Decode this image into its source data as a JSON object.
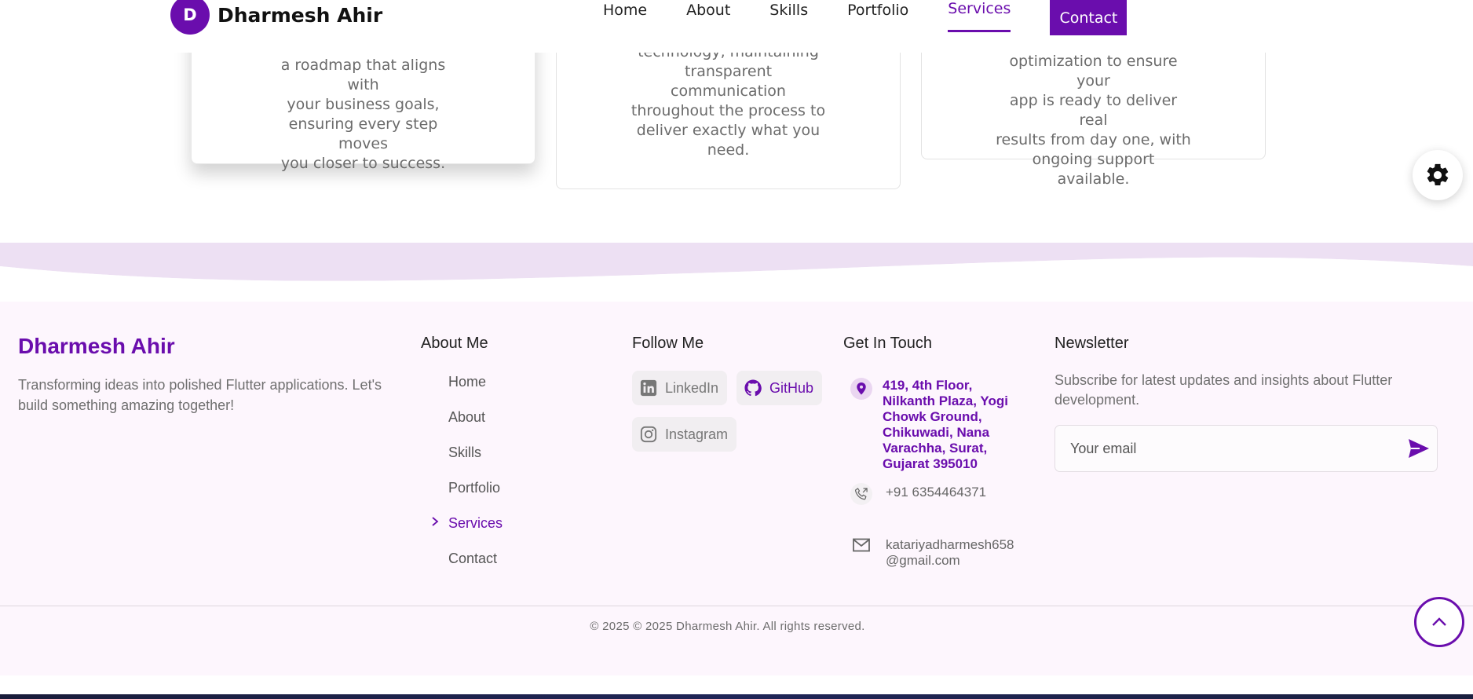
{
  "nav": {
    "avatar_letter": "D",
    "brand": "Dharmesh Ahir",
    "links": [
      "Home",
      "About",
      "Skills",
      "Portfolio",
      "Services"
    ],
    "active": "Services",
    "contact": "Contact"
  },
  "cards": [
    {
      "lines": [
        "a roadmap that aligns with",
        "your business goals,",
        "ensuring every step moves",
        "you closer to success."
      ]
    },
    {
      "lines": [
        "technology, maintaining",
        "transparent",
        "communication",
        "throughout the process to",
        "deliver exactly what you",
        "need."
      ]
    },
    {
      "lines": [
        "optimization to ensure your",
        "app is ready to deliver real",
        "results from day one, with",
        "ongoing support available."
      ]
    }
  ],
  "icons": {
    "settings": "gear-icon",
    "linkedin": "linkedin-icon",
    "github": "github-icon",
    "instagram": "instagram-icon",
    "location": "location-pin-icon",
    "phone": "phone-icon",
    "mail": "mail-icon",
    "send": "send-icon",
    "scroll_top": "chevron-up-icon",
    "chevron": "chevron-right-icon"
  },
  "footer": {
    "brand": "Dharmesh Ahir",
    "description": "Transforming ideas into polished Flutter applications. Let's build something amazing together!",
    "headings": {
      "about": "About Me",
      "follow": "Follow Me",
      "touch": "Get In Touch",
      "newsletter": "Newsletter"
    },
    "about_links": [
      "Home",
      "About",
      "Skills",
      "Portfolio",
      "Services",
      "Contact"
    ],
    "about_active": "Services",
    "social": {
      "linkedin": "LinkedIn",
      "github": "GitHub",
      "instagram": "Instagram"
    },
    "contact": {
      "address": "419, 4th Floor, Nilkanth Plaza, Yogi Chowk Ground, Chikuwadi, Nana Varachha, Surat, Gujarat 395010",
      "phone": "+91 6354464371",
      "email": "katariyadharmesh658@gmail.com"
    },
    "newsletter": {
      "description": "Subscribe for latest updates and insights about Flutter development.",
      "placeholder": "Your email"
    },
    "copyright": "© 2025 © 2025 Dharmesh Ahir. All rights reserved."
  },
  "colors": {
    "accent": "#6a0dad",
    "footer_bg": "#fdf6fd",
    "wave": "#ede0f3"
  }
}
